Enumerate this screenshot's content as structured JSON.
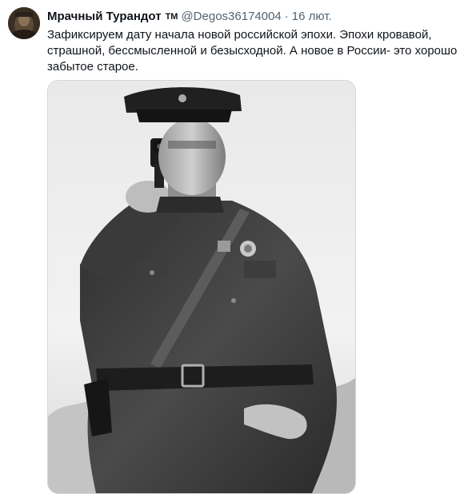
{
  "tweet": {
    "display_name": "Мрачный Турандот",
    "badge": "TM",
    "handle": "@Degos36174004",
    "separator": "·",
    "timestamp": "16 лют.",
    "text": "Зафиксируем дату начала новой российской эпохи. Эпохи кровавой, страшной, бессмысленной и безысходной. А новое в России- это хорошо забытое старое.",
    "avatar_icon": "profile-avatar",
    "media": {
      "icon": "photo-image",
      "style": "black-and-white vintage photograph"
    }
  },
  "colors": {
    "name": "#0f1419",
    "secondary": "#536471",
    "border": "#cfd9de"
  }
}
